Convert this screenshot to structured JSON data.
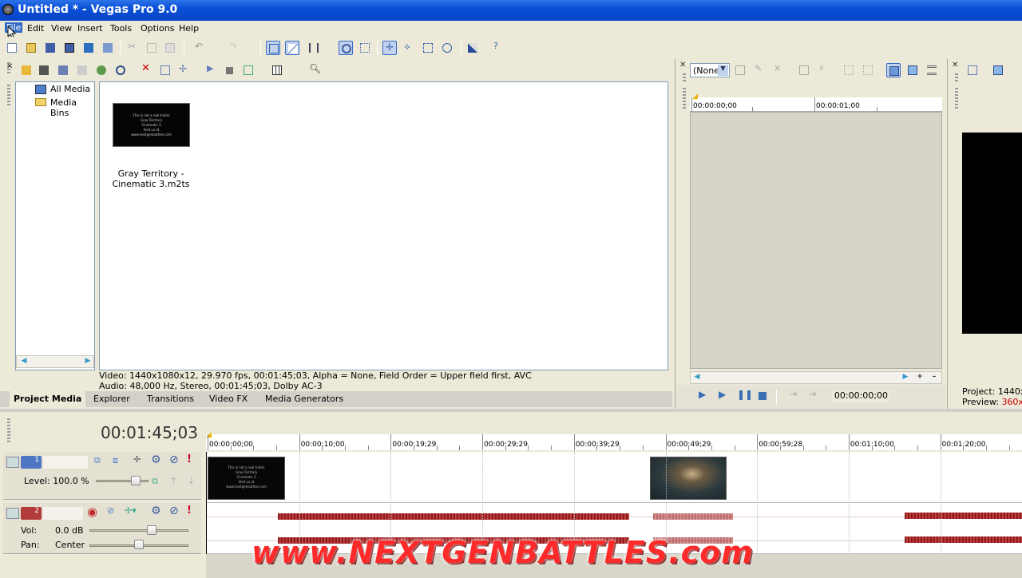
{
  "window": {
    "title": "Untitled * - Vegas Pro 9.0"
  },
  "menu": [
    "File",
    "Edit",
    "View",
    "Insert",
    "Tools",
    "Options",
    "Help"
  ],
  "project_media": {
    "tree": [
      {
        "label": "All Media",
        "icon": "media-icon"
      },
      {
        "label": "Media Bins",
        "icon": "folder-icon"
      }
    ],
    "clip": {
      "name": "Gray Territory - Cinematic 3.m2ts",
      "thumb_lines": [
        "This is not a real trailer",
        "Gray Territory",
        "Cinematic 3",
        "Visit us at",
        "www.nextgenbattles.com"
      ]
    },
    "info_video": "Video: 1440x1080x12, 29.970 fps, 00:01:45;03, Alpha = None, Field Order = Upper field first, AVC",
    "info_audio": "Audio: 48,000 Hz, Stereo, 00:01:45;03, Dolby AC-3"
  },
  "tabs": [
    "Project Media",
    "Explorer",
    "Transitions",
    "Video FX",
    "Media Generators"
  ],
  "trimmer": {
    "preset": "(None",
    "ruler": [
      "00:00:00;00",
      "00:00:01;00"
    ],
    "timecode": "00:00:00;00"
  },
  "preview": {
    "project_label": "Project:",
    "project_value": "1440x",
    "preview_label": "Preview:",
    "preview_value": "360x2"
  },
  "timeline": {
    "cursor_time": "00:01:45;03",
    "ruler": [
      "00:00:00;00",
      "00:00:10;00",
      "00:00:19;29",
      "00:00:29;29",
      "00:00:39;29",
      "00:00:49;29",
      "00:00:59;28",
      "00:01:10;00",
      "00:01:20;00"
    ],
    "video_track": {
      "number": "1",
      "level_label": "Level:",
      "level_value": "100.0 %",
      "level": 1.0
    },
    "audio_track": {
      "number": "2",
      "vol_label": "Vol:",
      "vol_value": "0.0 dB",
      "pan_label": "Pan:",
      "pan_value": "Center"
    }
  },
  "watermark": "www.NEXTGENBATTLES.com",
  "colors": {
    "titlebar": "#0a4fd6",
    "selection": "#316ac5",
    "audio_wave": "#8b1a1a",
    "watermark": "#ff2a2a"
  }
}
